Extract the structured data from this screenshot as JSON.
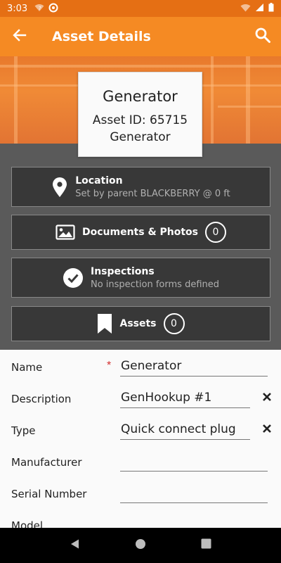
{
  "status_bar": {
    "time": "3:03",
    "left_icons": [
      "wifi-question-icon",
      "at-icon"
    ],
    "right_icons": [
      "wifi-icon",
      "signal-icon",
      "battery-icon"
    ]
  },
  "app_bar": {
    "title": "Asset Details",
    "back_icon": "arrow-left-icon",
    "search_icon": "search-icon",
    "color": "#f58a23"
  },
  "asset_card": {
    "name": "Generator",
    "asset_id": "Asset ID: 65715",
    "type_name": "Generator"
  },
  "tiles": {
    "location": {
      "title": "Location",
      "subtitle": "Set by parent BLACKBERRY @ 0 ft",
      "icon": "map-pin-icon"
    },
    "documents": {
      "title": "Documents & Photos",
      "count": "0",
      "icon": "image-icon"
    },
    "inspections": {
      "title": "Inspections",
      "subtitle": "No inspection forms defined",
      "icon": "check-circle-icon"
    },
    "assets": {
      "title": "Assets",
      "count": "0",
      "icon": "bookmark-icon"
    }
  },
  "form": {
    "name": {
      "label": "Name",
      "required_mark": "*",
      "value": "Generator"
    },
    "description": {
      "label": "Description",
      "value": "GenHookup #1"
    },
    "type": {
      "label": "Type",
      "value": "Quick connect plug"
    },
    "manufacturer": {
      "label": "Manufacturer",
      "value": ""
    },
    "serial_number": {
      "label": "Serial Number",
      "value": ""
    },
    "model": {
      "label": "Model",
      "value": ""
    }
  },
  "nav_bar": {
    "buttons": [
      "back-triangle-icon",
      "home-circle-icon",
      "recents-square-icon"
    ]
  }
}
